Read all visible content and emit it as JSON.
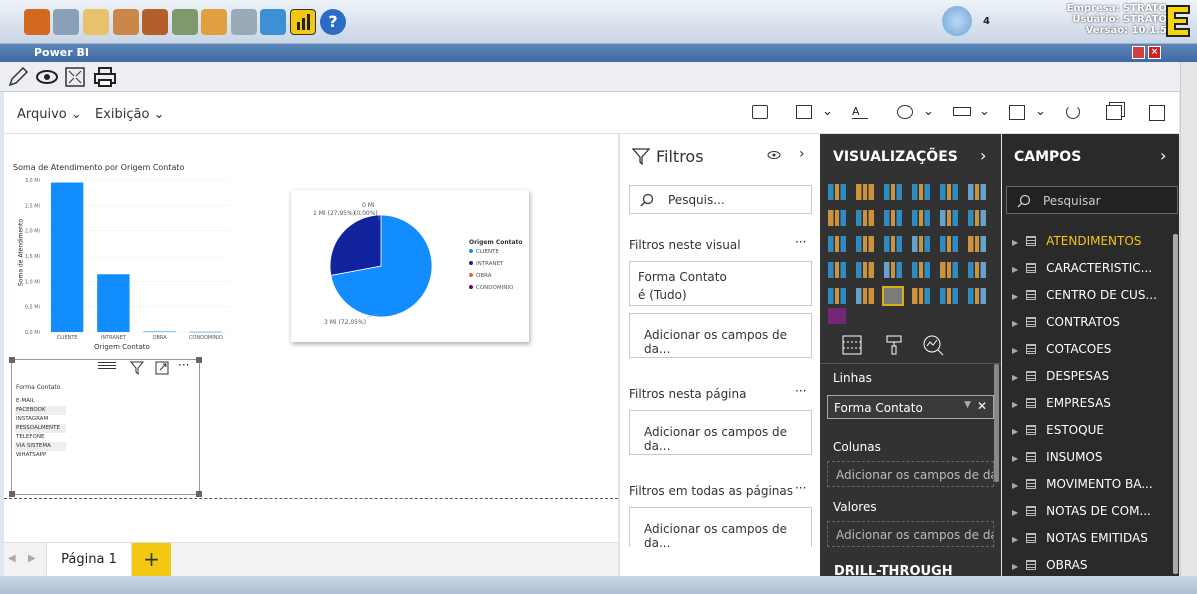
{
  "app": {
    "empresa_label": "Empresa:",
    "empresa_value": "STRATO",
    "usuario_label": "Usuário:",
    "usuario_value": "STRATO",
    "versao_label": "Versão:",
    "versao_value": "10.1.5",
    "notif_count": "4",
    "window_title": "Power BI",
    "help": "?"
  },
  "menu": {
    "arquivo": "Arquivo",
    "exibicao": "Exibição"
  },
  "canvas": {
    "bar_title": "Soma de Atendimento por Origem Contato",
    "bar_ylabel": "Soma de Atendimento",
    "bar_xlabel": "Origem Contato",
    "pie_legend_title": "Origem Contato",
    "pie_label_0": "0 Mi",
    "pie_label_0b": "(0,00%)",
    "pie_label_intranet": "1 Mi (27,95%)",
    "pie_label_cliente": "3 Mi (72,05%)",
    "table_header": "Forma Contato",
    "table_rows": [
      "E-MAIL",
      "FACEBOOK",
      "INSTAGRAM",
      "PESSOALMENTE",
      "TELEFONE",
      "VIA SISTEMA",
      "WHATSAPP"
    ]
  },
  "chart_data": [
    {
      "type": "bar",
      "title": "Soma de Atendimento por Origem Contato",
      "xlabel": "Origem Contato",
      "ylabel": "Soma de Atendimento",
      "categories": [
        "CLIENTE",
        "INTRANET",
        "OBRA",
        "CONDOMINIO"
      ],
      "values": [
        2.95,
        1.14,
        0.01,
        0.005
      ],
      "ylim": [
        0,
        3
      ],
      "yticks": [
        "0,0 Mi",
        "0,5 Mi",
        "1,0 Mi",
        "1,5 Mi",
        "2,0 Mi",
        "2,5 Mi",
        "3,0 Mi"
      ],
      "color": "#118dff"
    },
    {
      "type": "pie",
      "legend_title": "Origem Contato",
      "labels": [
        "CLIENTE",
        "INTRANET",
        "OBRA",
        "CONDOMINIO"
      ],
      "values": [
        72.05,
        27.95,
        0.0,
        0.0
      ],
      "colors": [
        "#118dff",
        "#12239e",
        "#e66c37",
        "#6b007b"
      ],
      "legend": "right"
    }
  ],
  "tabs": {
    "page1": "Página 1",
    "add": "+"
  },
  "filters": {
    "title": "Filtros",
    "search_placeholder": "Pesquis...",
    "visual_section": "Filtros neste visual",
    "filter_field": "Forma Contato",
    "filter_value": "é (Tudo)",
    "add_fields": "Adicionar os campos de da...",
    "page_section": "Filtros nesta página",
    "all_section": "Filtros em todas as páginas",
    "more": "···"
  },
  "viz": {
    "title": "VISUALIZAÇÕES",
    "rows_label": "Linhas",
    "rows_value": "Forma Contato",
    "cols_label": "Colunas",
    "cols_placeholder": "Adicionar os campos de da...",
    "values_label": "Valores",
    "values_placeholder": "Adicionar os campos de da...",
    "drill": "DRILL-THROUGH"
  },
  "fields": {
    "title": "CAMPOS",
    "search_placeholder": "Pesquisar",
    "items": [
      "ATENDIMENTOS",
      "CARACTERISTIC...",
      "CENTRO DE CUS...",
      "CONTRATOS",
      "COTACOES",
      "DESPESAS",
      "EMPRESAS",
      "ESTOQUE",
      "INSUMOS",
      "MOVIMENTO BA...",
      "NOTAS DE COM...",
      "NOTAS EMITIDAS",
      "OBRAS"
    ]
  }
}
